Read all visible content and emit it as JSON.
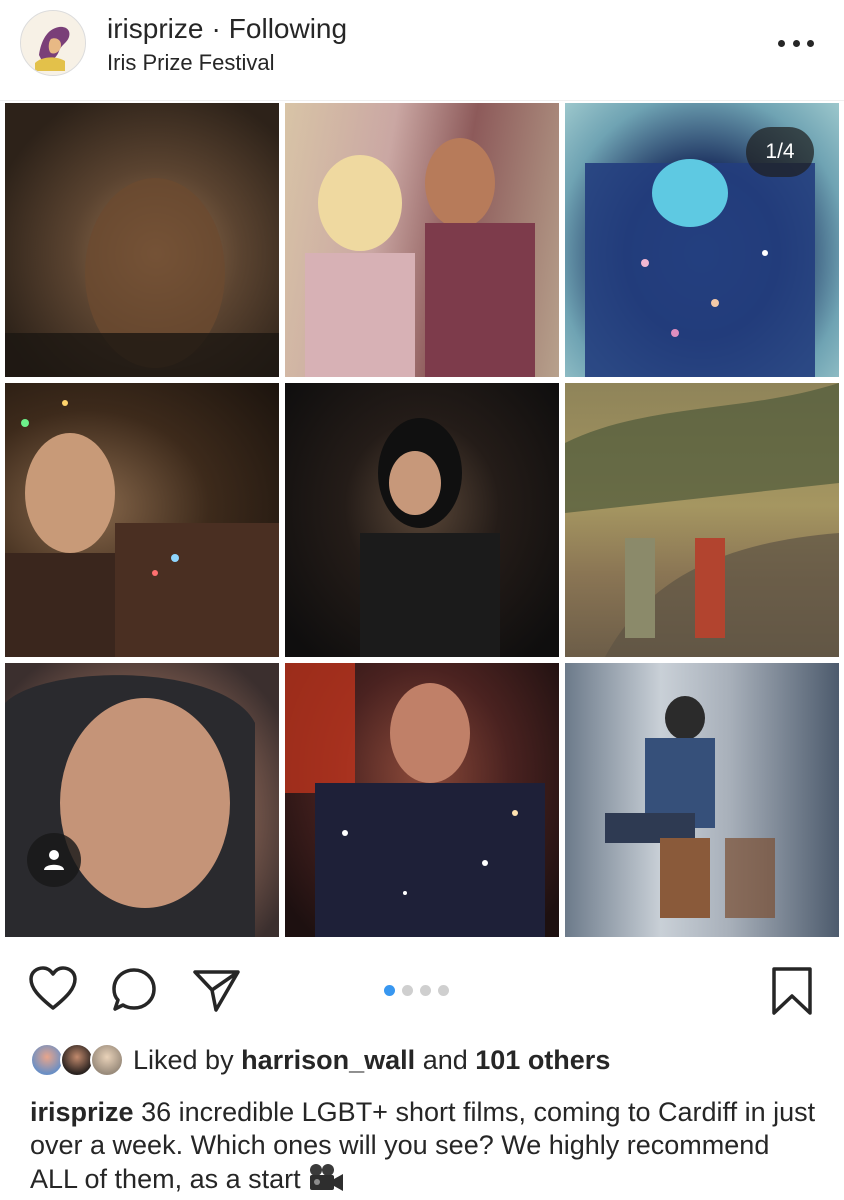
{
  "post": {
    "username": "irisprize",
    "separator": "·",
    "follow_status": "Following",
    "subtitle": "Iris Prize Festival",
    "carousel_counter": "1/4",
    "carousel_dots": 4,
    "carousel_active_index": 0,
    "icons": {
      "more": "more-horizontal-icon",
      "like": "heart-icon",
      "comment": "comment-icon",
      "share": "paper-plane-icon",
      "save": "bookmark-icon",
      "tag": "person-tag-icon",
      "caption_emoji": "movie-camera-icon"
    }
  },
  "likes": {
    "prefix": "Liked by",
    "user": "harrison_wall",
    "conjunction": "and",
    "others": "101 others"
  },
  "caption": {
    "username": "irisprize",
    "text": "36 incredible LGBT+ short films, coming to Cardiff in just over a week. Which ones will you see? We highly recommend ALL of them, as a start"
  },
  "colors": {
    "text": "#262626",
    "active_dot": "#3897f0",
    "inactive_dot": "#cfcfcf"
  }
}
